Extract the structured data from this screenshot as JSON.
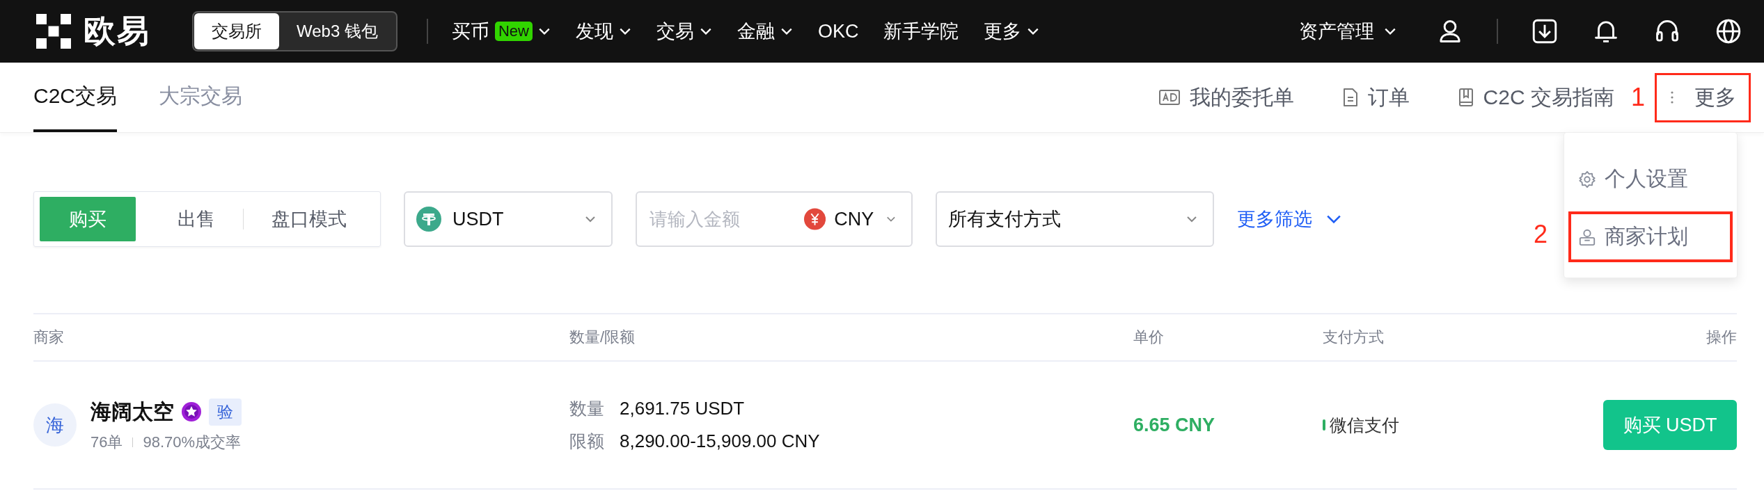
{
  "top_bar": {
    "logo": "欧易",
    "switch": [
      {
        "label": "交易所",
        "selected": true
      },
      {
        "label": "Web3 钱包",
        "selected": false
      }
    ],
    "nav": [
      {
        "label": "买币",
        "badge": "New",
        "caret": true
      },
      {
        "label": "发现",
        "caret": true
      },
      {
        "label": "交易",
        "caret": true
      },
      {
        "label": "金融",
        "caret": true
      },
      {
        "label": "OKC",
        "caret": false
      },
      {
        "label": "新手学院",
        "caret": false
      },
      {
        "label": "更多",
        "caret": true
      }
    ],
    "asset_menu": "资产管理"
  },
  "sub_nav": {
    "tabs": [
      {
        "label": "C2C交易",
        "selected": true
      },
      {
        "label": "大宗交易",
        "selected": false
      }
    ],
    "links": [
      {
        "label": "我的委托单"
      },
      {
        "label": "订单"
      },
      {
        "label": "C2C 交易指南"
      }
    ],
    "more": {
      "label": "更多",
      "highlighted": true,
      "annotation": "1"
    }
  },
  "menu": {
    "items": [
      {
        "label": "个人设置",
        "highlighted": false
      },
      {
        "label": "商家计划",
        "highlighted": true,
        "annotation": "2"
      }
    ]
  },
  "filters": {
    "side": [
      {
        "label": "购买",
        "selected": true
      },
      {
        "label": "出售",
        "selected": false
      },
      {
        "label": "盘口模式",
        "selected": false
      }
    ],
    "coin": {
      "value": "USDT"
    },
    "amount": {
      "placeholder": "请输入金额",
      "currency": "CNY"
    },
    "payment": {
      "value": "所有支付方式"
    },
    "more_filters": "更多筛选"
  },
  "table": {
    "columns": [
      "商家",
      "数量/限额",
      "单价",
      "支付方式",
      "操作"
    ],
    "rows": [
      {
        "avatar": "海",
        "name": "海阔太空",
        "verified": "验",
        "orders": "76单",
        "rate": "98.70%成交率",
        "quantity_label": "数量",
        "quantity": "2,691.75 USDT",
        "limit_label": "限额",
        "limit": "8,290.00-15,909.00 CNY",
        "price": "6.65 CNY",
        "payment": "微信支付",
        "action": "购买 USDT"
      }
    ]
  }
}
